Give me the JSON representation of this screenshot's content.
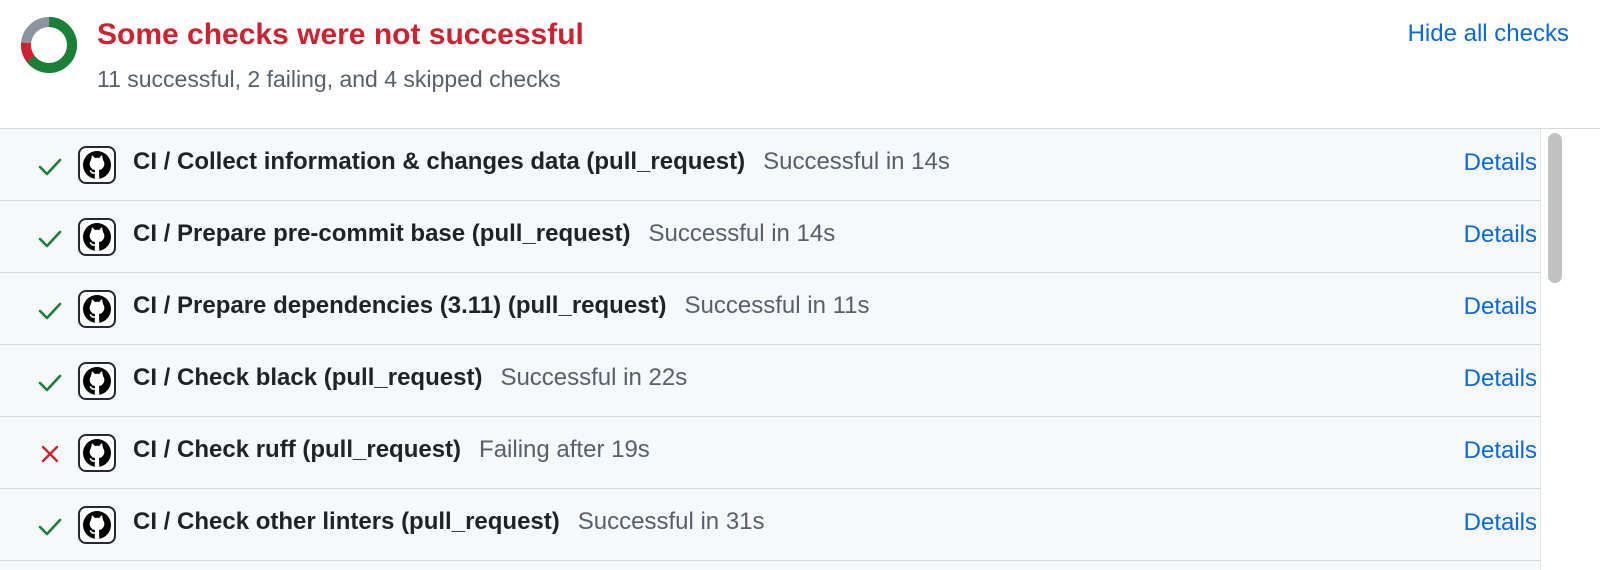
{
  "summary": {
    "title": "Some checks were not successful",
    "subtitle": "11 successful, 2 failing, and 4 skipped checks",
    "hide_link": "Hide all checks",
    "donut_icon": "status-donut",
    "counts": {
      "successful": 11,
      "failing": 2,
      "skipped": 4
    }
  },
  "colors": {
    "success": "#1a7f37",
    "failure": "#cf222e",
    "skipped": "#8c959f",
    "link": "#0969da",
    "title_fail": "#cf222e",
    "row_bg": "#f6f8fa"
  },
  "checks": [
    {
      "name": "CI / Collect information & changes data (pull_request)",
      "status_text": "Successful in 14s",
      "state": "success",
      "status_icon": "check-icon",
      "app_icon": "github-icon",
      "details": "Details"
    },
    {
      "name": "CI / Prepare pre-commit base (pull_request)",
      "status_text": "Successful in 14s",
      "state": "success",
      "status_icon": "check-icon",
      "app_icon": "github-icon",
      "details": "Details"
    },
    {
      "name": "CI / Prepare dependencies (3.11) (pull_request)",
      "status_text": "Successful in 11s",
      "state": "success",
      "status_icon": "check-icon",
      "app_icon": "github-icon",
      "details": "Details"
    },
    {
      "name": "CI / Check black (pull_request)",
      "status_text": "Successful in 22s",
      "state": "success",
      "status_icon": "check-icon",
      "app_icon": "github-icon",
      "details": "Details"
    },
    {
      "name": "CI / Check ruff (pull_request)",
      "status_text": "Failing after 19s",
      "state": "failure",
      "status_icon": "x-icon",
      "app_icon": "github-icon",
      "details": "Details"
    },
    {
      "name": "CI / Check other linters (pull_request)",
      "status_text": "Successful in 31s",
      "state": "success",
      "status_icon": "check-icon",
      "app_icon": "github-icon",
      "details": "Details"
    }
  ]
}
